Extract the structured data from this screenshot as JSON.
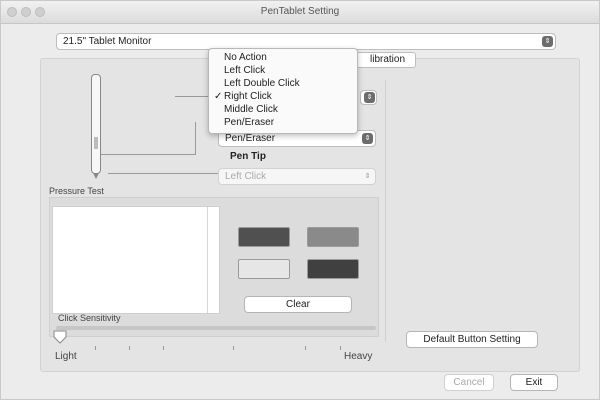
{
  "window": {
    "title": "PenTablet Setting"
  },
  "monitor_select": {
    "value": "21.5\" Tablet Monitor"
  },
  "tabs": {
    "calibration": "libration"
  },
  "dropdown_menu": {
    "items": [
      "No Action",
      "Left Click",
      "Left Double Click",
      "Right Click",
      "Middle Click",
      "Pen/Eraser"
    ],
    "checked": "Right Click"
  },
  "pen_button_select": {
    "value": "Pen/Eraser"
  },
  "pen_tip": {
    "label": "Pen Tip",
    "value": "Left Click"
  },
  "pressure_test": {
    "label": "Pressure Test",
    "clear_label": "Clear"
  },
  "click_sensitivity": {
    "label": "Click Sensitivity",
    "min_label": "Light",
    "max_label": "Heavy",
    "level": 0
  },
  "buttons": {
    "default_setting": "Default Button Setting",
    "cancel": "Cancel",
    "exit": "Exit"
  },
  "colors": {
    "swatch1": "#505050",
    "swatch2": "#8a8a8a",
    "swatch3": "#e6e6e6",
    "swatch4": "#404040"
  }
}
